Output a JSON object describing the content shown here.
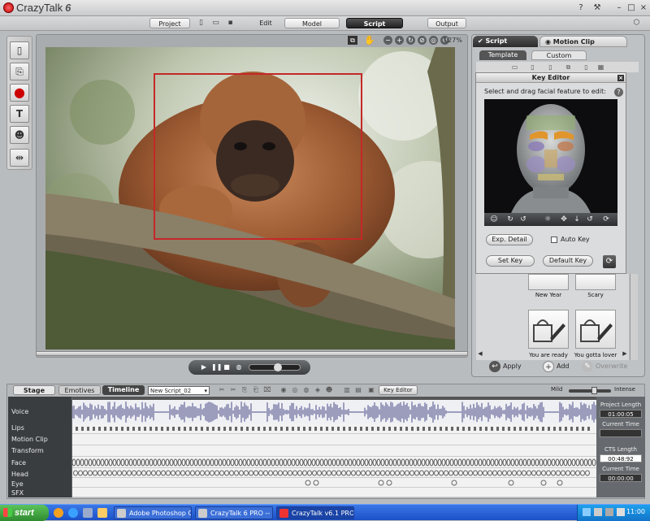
{
  "app": {
    "name": "CrazyTalk",
    "version": "6"
  },
  "window_controls": [
    "?",
    "⚒",
    "–",
    "□",
    "×"
  ],
  "main_tabs": {
    "project": "Project",
    "edit": "Edit",
    "model": "Model",
    "script": "Script",
    "output": "Output"
  },
  "viewer": {
    "zoom": "127%"
  },
  "right_panel": {
    "tab_script": "Script",
    "tab_motion_clip": "Motion Clip",
    "sub_template": "Template",
    "sub_custom": "Custom",
    "key_editor": {
      "title": "Key Editor",
      "instruction": "Select and drag facial feature to edit:",
      "exp_detail": "Exp. Detail",
      "auto_key": "Auto Key",
      "set_key": "Set Key",
      "default_key": "Default Key"
    },
    "templates": [
      {
        "label": "New Year"
      },
      {
        "label": "Scary"
      },
      {
        "label": "You are ready"
      },
      {
        "label": "You gotta lover"
      }
    ],
    "actions": {
      "apply": "Apply",
      "add": "Add",
      "overwrite": "Overwrite"
    }
  },
  "timeline": {
    "tabs": {
      "stage": "Stage",
      "emotives": "Emotives",
      "timeline": "Timeline"
    },
    "script_name": "New Script_02",
    "key_editor_btn": "Key Editor",
    "slider": {
      "min_label": "Mild",
      "max_label": "Intense",
      "value": 0.62
    },
    "tracks": [
      "Voice",
      "Lips",
      "Motion Clip",
      "Transform",
      "Face",
      "Head",
      "Eye",
      "SFX"
    ],
    "project_length_label": "Project Length",
    "project_length": "01:00:05",
    "current_time_label": "Current Time",
    "cts_length_label": "CTS Length",
    "cts_length": "00:48:92",
    "current_time_label2": "Current Time",
    "current_time2": "00:00:00"
  },
  "taskbar": {
    "start": "start",
    "items": [
      "Adobe Photoshop CS...",
      "CrazyTalk 6 PRO -- C...",
      "CrazyTalk v6.1 PRO"
    ],
    "clock": "11:00"
  },
  "colors": {
    "face_box": "#c42828",
    "accent_dark": "#2a2c2e",
    "taskbar": "#245edc"
  }
}
